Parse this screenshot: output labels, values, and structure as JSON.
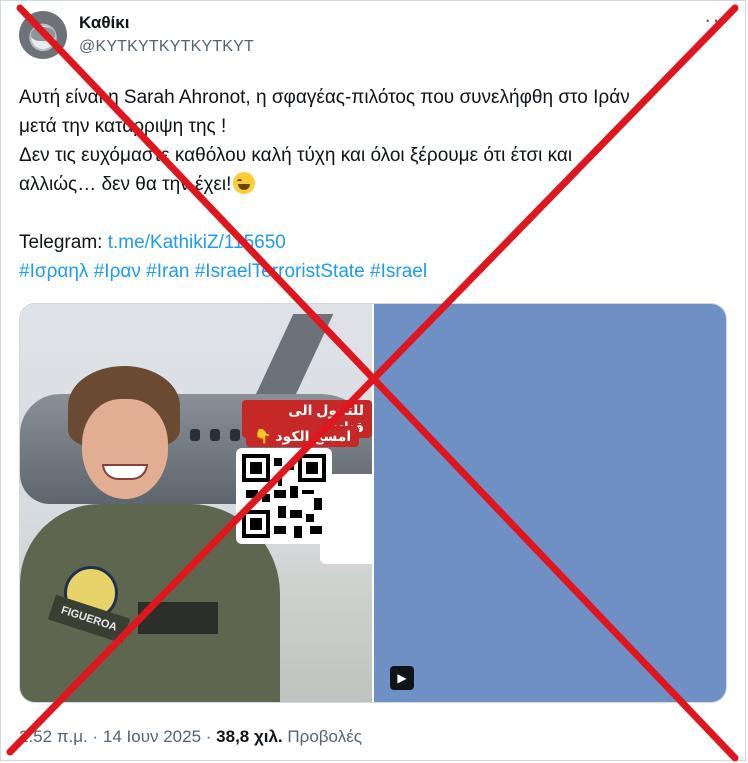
{
  "author": {
    "display_name": "Καθίκι",
    "handle": "@KYTKYTKYTKYTKYT"
  },
  "more_label": "···",
  "tweet": {
    "line1": "Αυτή είναι η Sarah Ahronot, η σφαγέας-πιλότος που συνελήφθη στο Ιράν",
    "line2": "μετά την κατάρριψη της !",
    "line3": "Δεν τις ευχόμαστε καθόλου καλή τύχη και όλοι ξέρουμε ότι έτσι και",
    "line4": "αλλιώς… δεν θα την έχει!",
    "telegram_label": "Telegram: ",
    "telegram_link": "t.me/KathikiZ/115650",
    "hashtags": [
      "#Ισραηλ",
      "#Ιραν",
      "#Iran",
      "#IsraelTerroristState",
      "#Israel"
    ]
  },
  "media": {
    "overlay_line1": "للتحول الى قناتنا",
    "overlay_line2": "امسح الكود 👇",
    "name_tag": "FIGUEROA",
    "play_icon": "play-icon"
  },
  "meta": {
    "time": "2:52 π.μ.",
    "separator": " · ",
    "date": "14 Ιουν 2025",
    "views_count": "38,8 χιλ.",
    "views_label": " Προβολές"
  },
  "colors": {
    "link": "#1d9bf0",
    "cross": "#e0161e",
    "secondary_text": "#536471"
  }
}
